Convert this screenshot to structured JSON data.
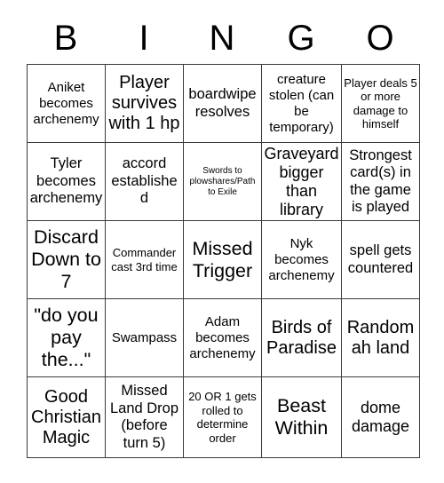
{
  "card": {
    "title": "BINGO",
    "header_letters": [
      "B",
      "I",
      "N",
      "G",
      "O"
    ],
    "colors": {
      "background": "#ffffff",
      "text": "#000000",
      "grid_line": "#3a3a3a"
    },
    "grid": {
      "rows": 5,
      "columns": 5,
      "cells": [
        [
          {
            "text": "Aniket becomes archenemy",
            "size": "fs-15"
          },
          {
            "text": "Player survives with 1 hp",
            "size": "fs-20"
          },
          {
            "text": "boardwipe resolves",
            "size": "fs-16"
          },
          {
            "text": "creature stolen (can be temporary)",
            "size": "fs-15"
          },
          {
            "text": "Player deals 5 or more damage to himself",
            "size": "fs-13"
          }
        ],
        [
          {
            "text": "Tyler becomes archenemy",
            "size": "fs-16"
          },
          {
            "text": "accord established",
            "size": "fs-16"
          },
          {
            "text": "Swords to plowshares/Path to Exile",
            "size": "fs-10"
          },
          {
            "text": "Graveyard bigger than library",
            "size": "fs-18"
          },
          {
            "text": "Strongest card(s) in the game is played",
            "size": "fs-16"
          }
        ],
        [
          {
            "text": "Discard Down to 7",
            "size": "fs-22"
          },
          {
            "text": "Commander cast 3rd time",
            "size": "fs-13"
          },
          {
            "text": "Missed Trigger",
            "size": "fs-22"
          },
          {
            "text": "Nyk becomes archenemy",
            "size": "fs-15"
          },
          {
            "text": "spell gets countered",
            "size": "fs-16"
          }
        ],
        [
          {
            "text": "\"do you pay the...\"",
            "size": "fs-22"
          },
          {
            "text": "Swampass",
            "size": "fs-15"
          },
          {
            "text": "Adam becomes archenemy",
            "size": "fs-15"
          },
          {
            "text": "Birds of Paradise",
            "size": "fs-20"
          },
          {
            "text": "Random ah land",
            "size": "fs-20"
          }
        ],
        [
          {
            "text": "Good Christian Magic",
            "size": "fs-20"
          },
          {
            "text": "Missed Land Drop (before turn 5)",
            "size": "fs-16"
          },
          {
            "text": "20 OR 1 gets rolled to determine order",
            "size": "fs-13"
          },
          {
            "text": "Beast Within",
            "size": "fs-22"
          },
          {
            "text": "dome damage",
            "size": "fs-18"
          }
        ]
      ]
    }
  }
}
